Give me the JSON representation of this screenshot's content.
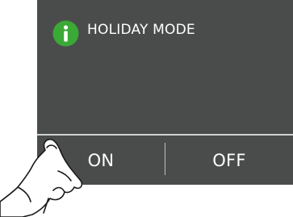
{
  "panel": {
    "title": "HOLIDAY MODE",
    "icon": "info-icon",
    "icon_color": "#3aa935",
    "background": "#4a4c4c"
  },
  "buttons": {
    "on_label": "ON",
    "off_label": "OFF"
  }
}
